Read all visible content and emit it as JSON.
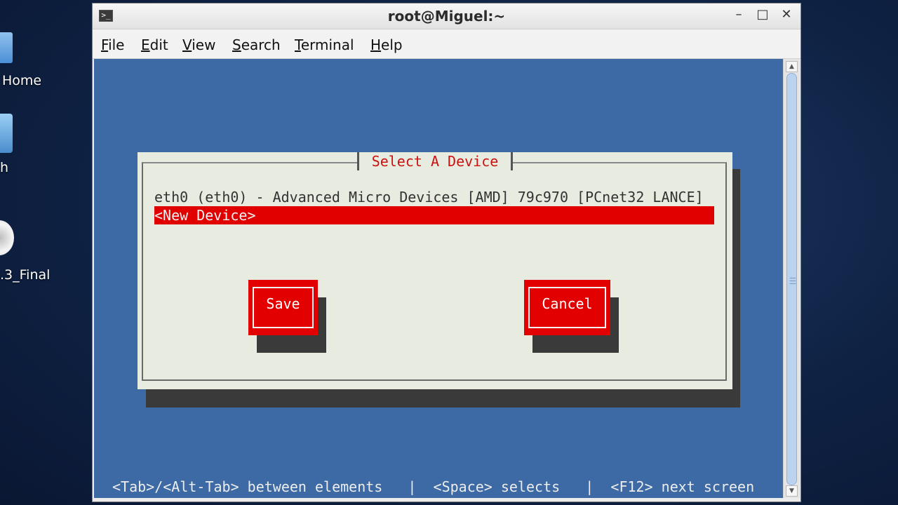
{
  "desktop": {
    "icons": [
      {
        "label": "Home",
        "icon": "home-folder-icon"
      },
      {
        "label": "h",
        "icon": "trash-icon"
      },
      {
        "label": ".3_Final",
        "icon": "dvd-icon"
      }
    ]
  },
  "window": {
    "title": "root@Miguel:~",
    "controls": {
      "minimize": "–",
      "maximize": "□",
      "close": "✕"
    },
    "menu": [
      "File",
      "Edit",
      "View",
      "Search",
      "Terminal",
      "Help"
    ]
  },
  "dialog": {
    "title": "Select A Device",
    "devices": [
      {
        "label": "eth0 (eth0) - Advanced Micro Devices [AMD] 79c970 [PCnet32 LANCE]",
        "selected": false
      },
      {
        "label": "<New Device>",
        "selected": true
      }
    ],
    "buttons": {
      "save": "Save",
      "cancel": "Cancel"
    }
  },
  "statusbar": {
    "text": "<Tab>/<Alt-Tab> between elements   |  <Space> selects   |  <F12> next screen"
  },
  "colors": {
    "terminal_bg": "#3d6aa4",
    "dialog_bg": "#e8ebdf",
    "accent_red": "#e00000",
    "title_red": "#cc1111",
    "shadow": "#3a3a3a"
  }
}
